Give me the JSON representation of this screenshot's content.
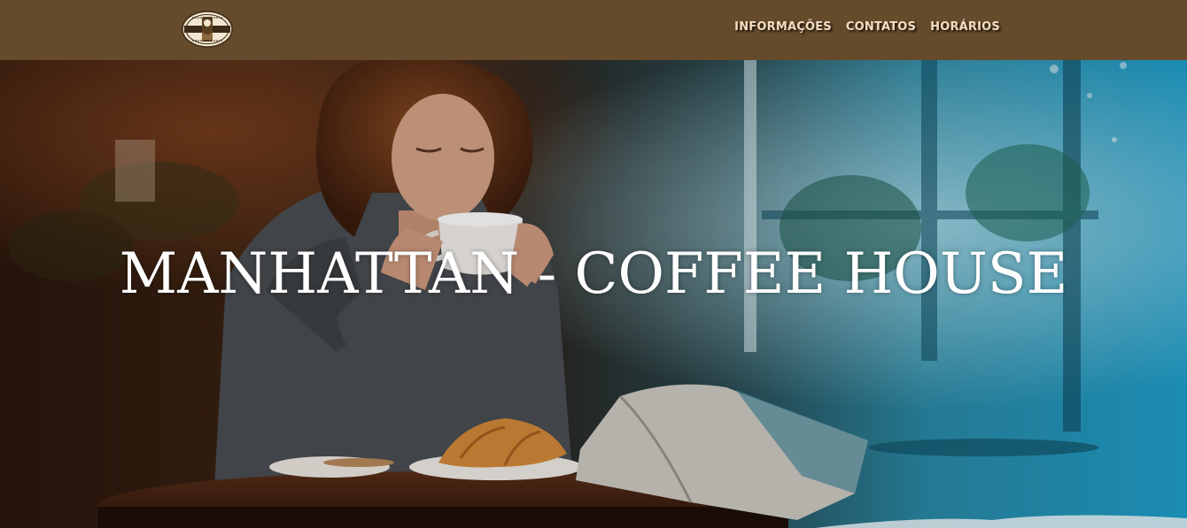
{
  "header": {
    "logo_icon": "manhattan-coffee-house-seal-logo",
    "nav": [
      {
        "label": "INFORMAÇÕES"
      },
      {
        "label": "CONTATOS"
      },
      {
        "label": "HORÁRIOS"
      }
    ]
  },
  "hero": {
    "title": "MANHATTAN - COFFEE HOUSE",
    "image": "photo-woman-drinking-coffee-croissant-cafe"
  },
  "colors": {
    "navbar_bg": "#654a2c",
    "nav_text": "#f3dcc0",
    "hero_text": "#ffffff"
  }
}
